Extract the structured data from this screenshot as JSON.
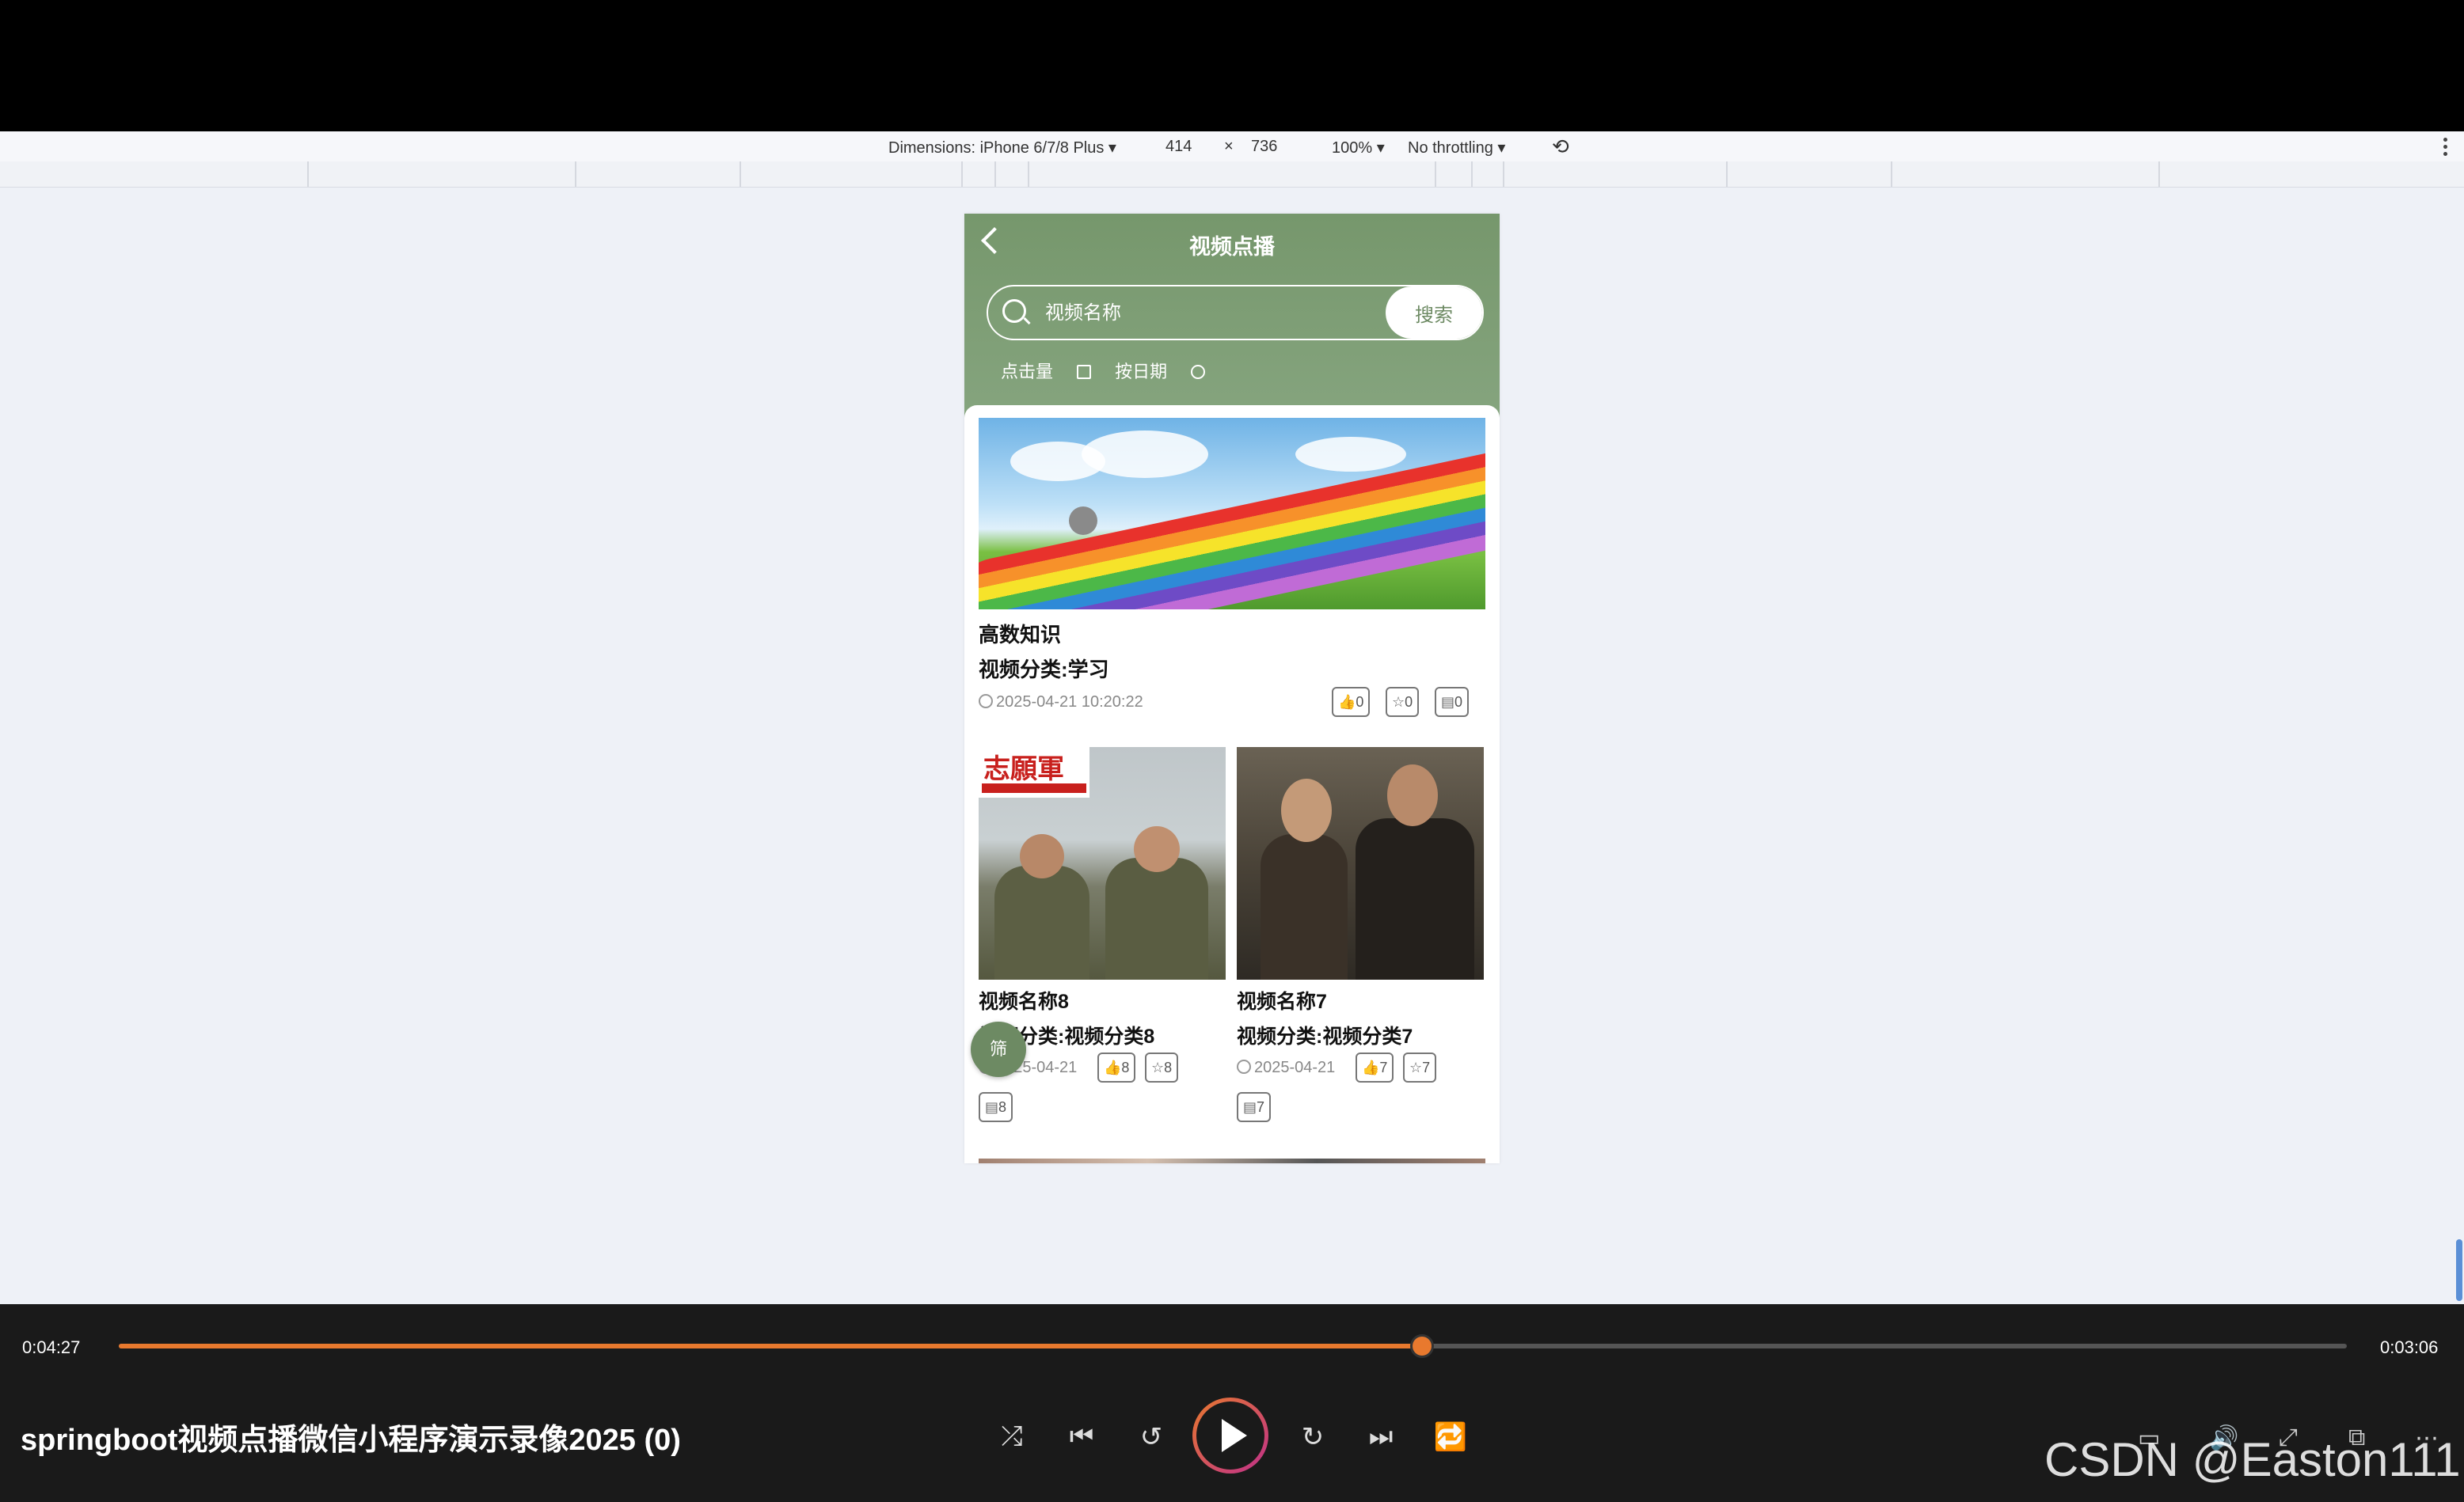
{
  "devtools": {
    "dimensions_label": "Dimensions: iPhone 6/7/8 Plus ▾",
    "width": "414",
    "times": "×",
    "height": "736",
    "zoom": "100% ▾",
    "throttling": "No throttling ▾"
  },
  "app": {
    "title": "视频点播",
    "search_placeholder": "视频名称",
    "search_button": "搜索",
    "sort_clicks": "点击量",
    "sort_date": "按日期",
    "float_button": "筛"
  },
  "featured": {
    "name": "高数知识",
    "category": "视频分类:学习",
    "date": "2025-04-21 10:20:22",
    "likes": "0",
    "favorites": "0",
    "comments": "0"
  },
  "cards": [
    {
      "name": "视频名称8",
      "category": "视频分类:视频分类8",
      "date": "2025-04-21",
      "likes": "8",
      "favorites": "8",
      "comments": "8",
      "poster_text": "志願軍"
    },
    {
      "name": "视频名称7",
      "category": "视频分类:视频分类7",
      "date": "2025-04-21",
      "likes": "7",
      "favorites": "7",
      "comments": "7"
    }
  ],
  "player": {
    "current_time": "0:04:27",
    "total_time": "0:03:06",
    "progress": 0.585,
    "title": "springboot视频点播微信小程序演示录像2025 (0)",
    "watermark": "CSDN @Easton111"
  },
  "colors": {
    "header_green": "#76976c",
    "accent_orange": "#e8792e"
  }
}
